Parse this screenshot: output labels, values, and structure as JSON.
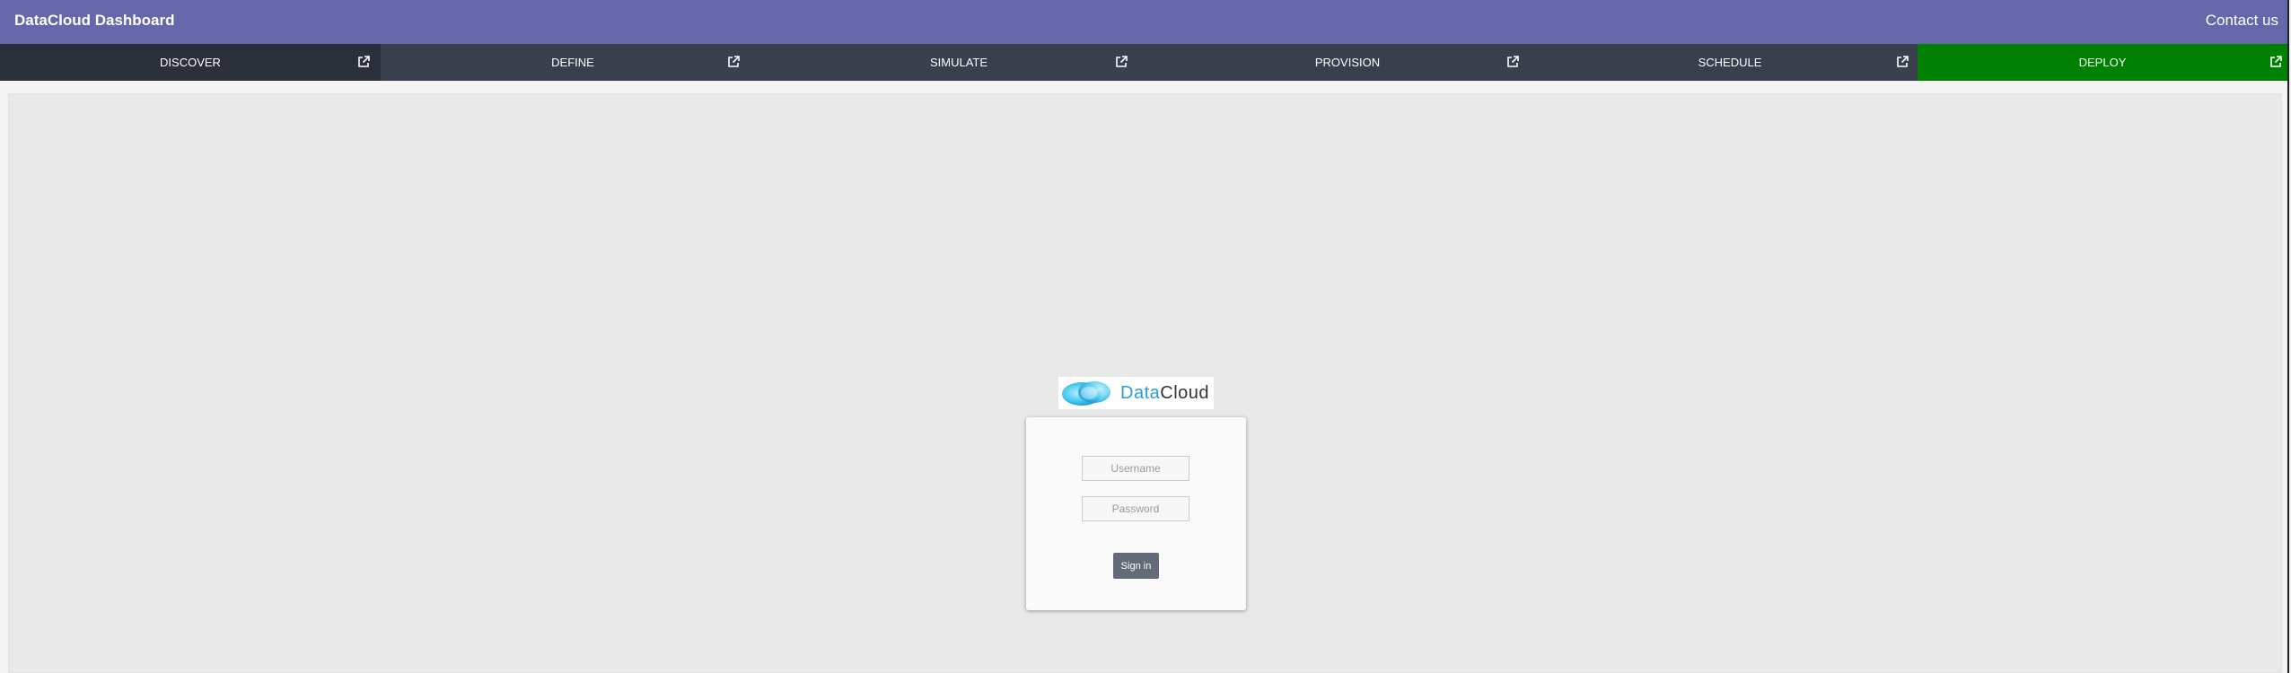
{
  "header": {
    "title": "DataCloud Dashboard",
    "contact_label": "Contact us",
    "background": "#6667ab"
  },
  "nav": {
    "items": [
      {
        "label": "DISCOVER",
        "icon": "external-link-icon",
        "color": "#2b2f39",
        "active": false
      },
      {
        "label": "DEFINE",
        "icon": "external-link-icon",
        "color": "#393f4d",
        "active": false
      },
      {
        "label": "SIMULATE",
        "icon": "external-link-icon",
        "color": "#393f4d",
        "active": false
      },
      {
        "label": "PROVISION",
        "icon": "external-link-icon",
        "color": "#393f4d",
        "active": false
      },
      {
        "label": "SCHEDULE",
        "icon": "external-link-icon",
        "color": "#393f4d",
        "active": false
      },
      {
        "label": "DEPLOY",
        "icon": "external-link-icon",
        "color": "#008000",
        "active": true
      }
    ]
  },
  "logo": {
    "text_part1": "Data",
    "text_part2": "Cloud",
    "icon": "cloud-logo-icon"
  },
  "login": {
    "username_placeholder": "Username",
    "username_value": "",
    "password_placeholder": "Password",
    "password_value": "",
    "signin_label": "Sign in"
  }
}
